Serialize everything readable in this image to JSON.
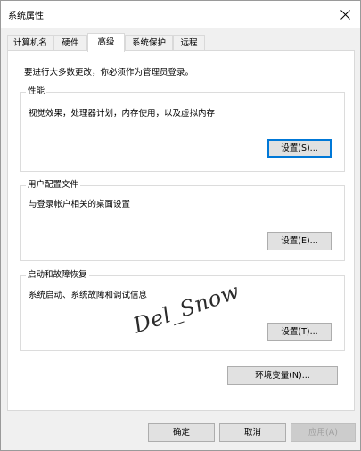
{
  "window": {
    "title": "系统属性"
  },
  "tabs": [
    {
      "label": "计算机名"
    },
    {
      "label": "硬件"
    },
    {
      "label": "高级"
    },
    {
      "label": "系统保护"
    },
    {
      "label": "远程"
    }
  ],
  "active_tab": "高级",
  "admin_note": "要进行大多数更改，你必须作为管理员登录。",
  "performance": {
    "title": "性能",
    "description": "视觉效果，处理器计划，内存使用，以及虚拟内存",
    "button_label": "设置(S)..."
  },
  "user_profiles": {
    "title": "用户配置文件",
    "description": "与登录帐户相关的桌面设置",
    "button_label": "设置(E)..."
  },
  "startup_recovery": {
    "title": "启动和故障恢复",
    "description": "系统启动、系统故障和调试信息",
    "button_label": "设置(T)..."
  },
  "env_button_label": "环境变量(N)...",
  "watermark_text": "Del_Snow",
  "footer": {
    "ok_label": "确定",
    "cancel_label": "取消",
    "apply_label": "应用(A)"
  },
  "colors": {
    "focus_border": "#0078d7",
    "window_bg": "#f0f0f0",
    "panel_bg": "#ffffff"
  },
  "icons": {
    "close": "close-icon"
  }
}
